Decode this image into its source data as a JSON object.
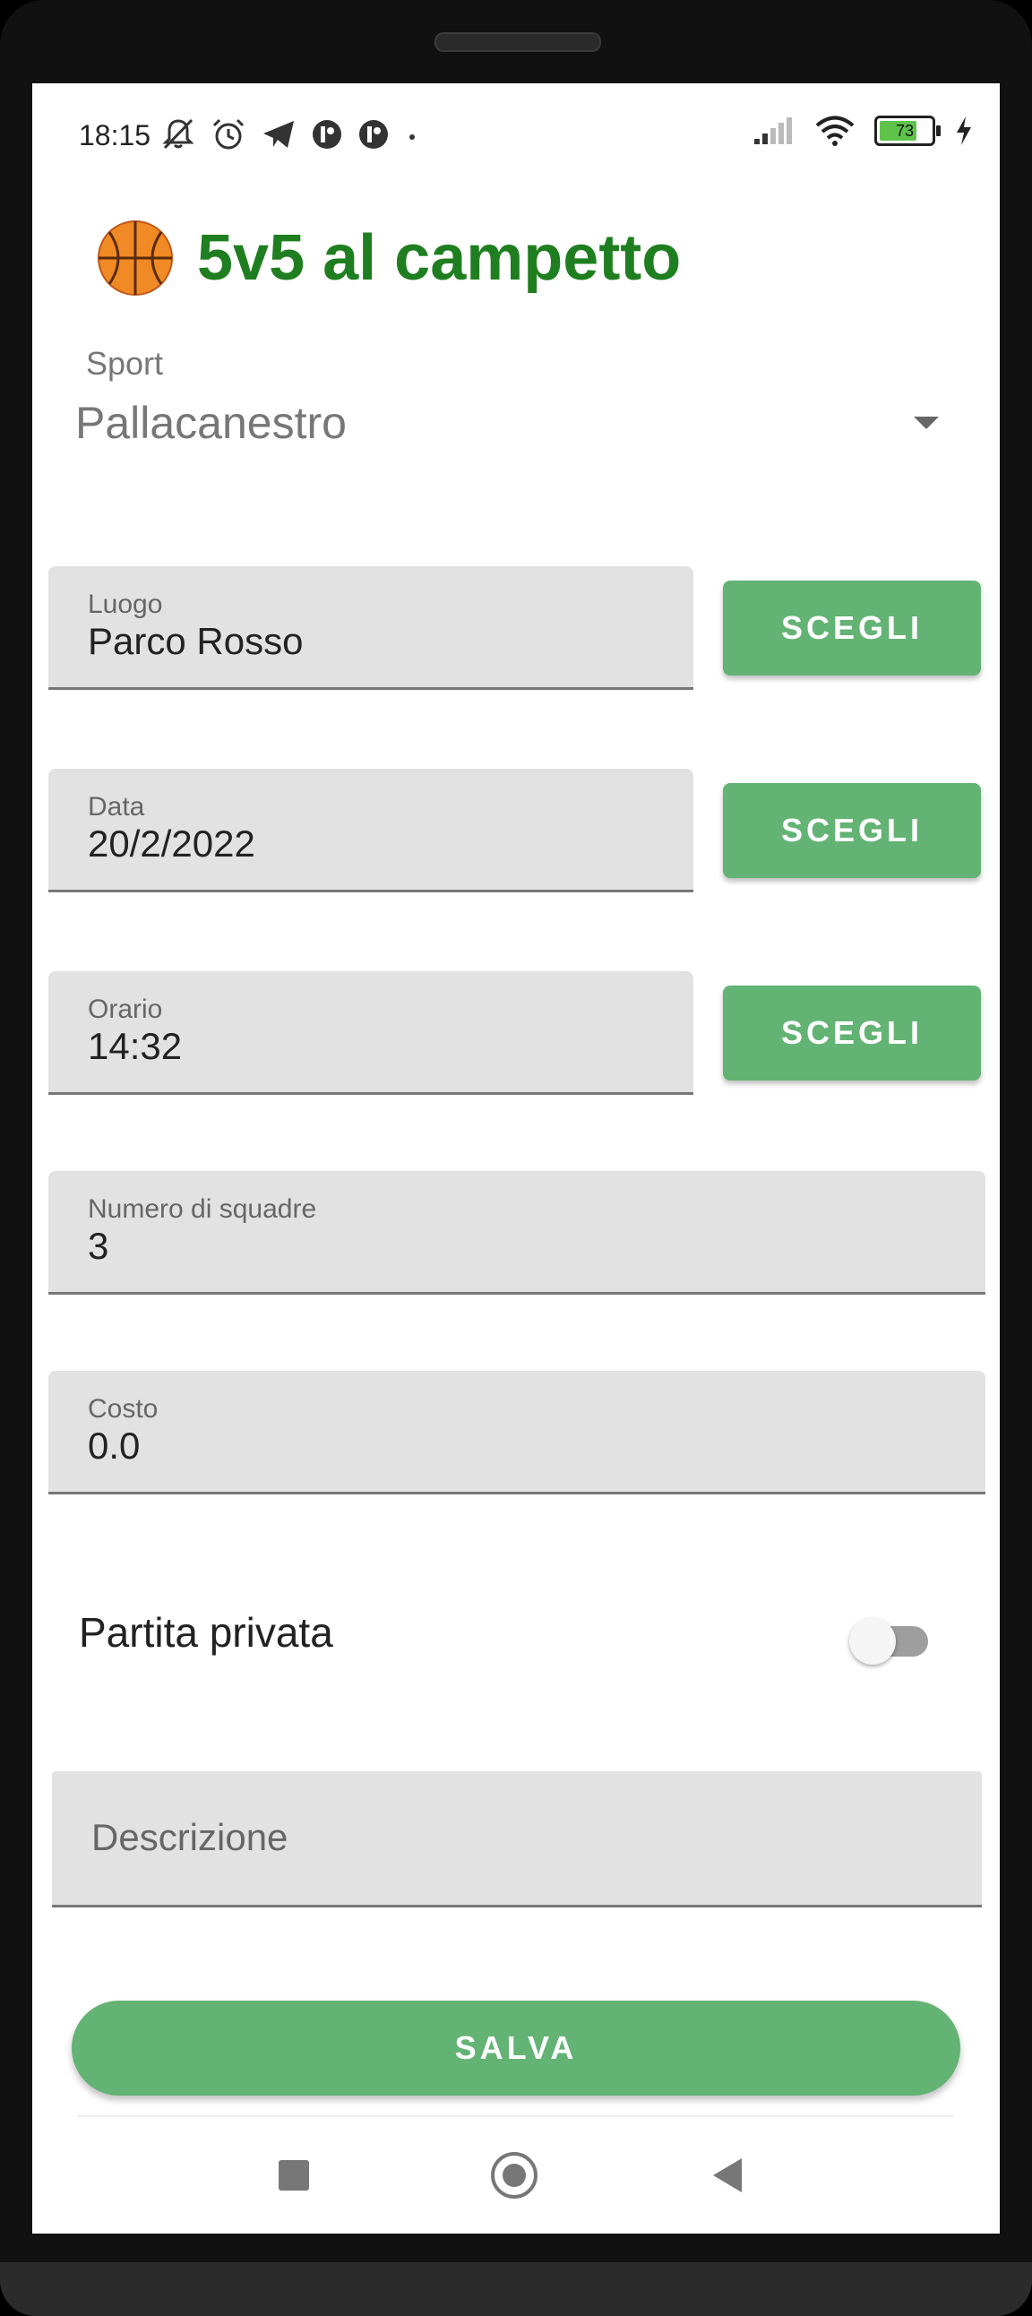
{
  "status_bar": {
    "time": "18:15",
    "battery_level": "73",
    "battery_fraction": 0.73,
    "icons_left": [
      "mute-icon",
      "alarm-icon",
      "telegram-icon",
      "app-icon",
      "app-icon"
    ],
    "icons_right": [
      "signal-icon",
      "wifi-icon",
      "battery-icon",
      "charging-icon"
    ]
  },
  "header": {
    "emoji_icon": "basketball-icon",
    "title": "5v5 al campetto",
    "title_color": "#1f7e1f"
  },
  "sport": {
    "label": "Sport",
    "value": "Pallacanestro"
  },
  "form": {
    "location": {
      "label": "Luogo",
      "value": "Parco Rosso"
    },
    "date": {
      "label": "Data",
      "value": "20/2/2022"
    },
    "time": {
      "label": "Orario",
      "value": "14:32"
    },
    "teams": {
      "label": "Numero di squadre",
      "value": "3"
    },
    "cost": {
      "label": "Costo",
      "value": "0.0"
    },
    "private_label": "Partita privata",
    "private_enabled": false,
    "description_placeholder": "Descrizione"
  },
  "buttons": {
    "choose_label": "SCEGLI",
    "save_label": "SALVA",
    "accent_color": "#63b374"
  },
  "nav": [
    "recents-icon",
    "home-icon",
    "back-icon"
  ]
}
